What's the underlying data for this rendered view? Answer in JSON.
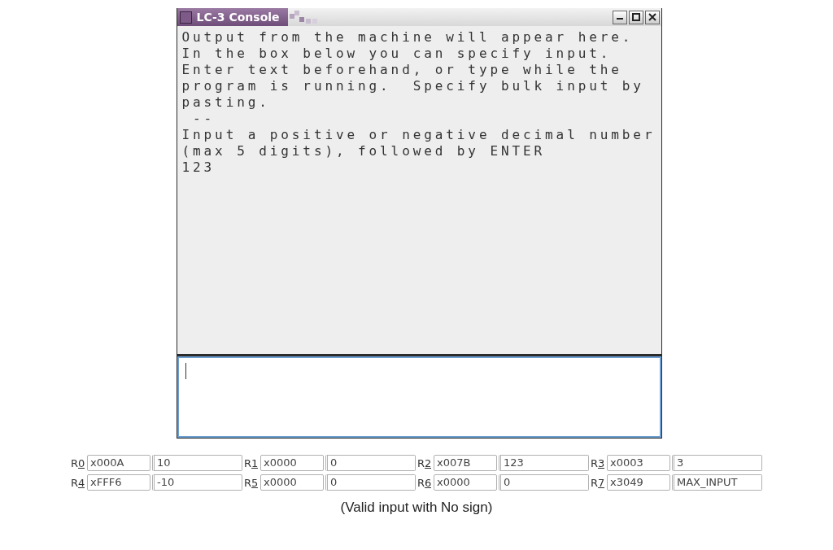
{
  "window": {
    "title": "LC-3 Console"
  },
  "console_output": {
    "lines": [
      "Output from the machine will appear here.",
      "In the box below you can specify input.",
      "Enter text beforehand, or type while the",
      "program is running.  Specify bulk input by",
      "pasting.",
      " --",
      "Input a positive or negative decimal number",
      "(max 5 digits), followed by ENTER",
      "123"
    ]
  },
  "input_box": {
    "focused": true
  },
  "registers": [
    {
      "label": "R0",
      "hex": "x000A",
      "value": "10"
    },
    {
      "label": "R1",
      "hex": "x0000",
      "value": "0"
    },
    {
      "label": "R2",
      "hex": "x007B",
      "value": "123"
    },
    {
      "label": "R3",
      "hex": "x0003",
      "value": "3"
    },
    {
      "label": "R4",
      "hex": "xFFF6",
      "value": "-10"
    },
    {
      "label": "R5",
      "hex": "x0000",
      "value": "0"
    },
    {
      "label": "R6",
      "hex": "x0000",
      "value": "0"
    },
    {
      "label": "R7",
      "hex": "x3049",
      "value": "MAX_INPUT"
    }
  ],
  "caption": "(Valid input with No sign)"
}
